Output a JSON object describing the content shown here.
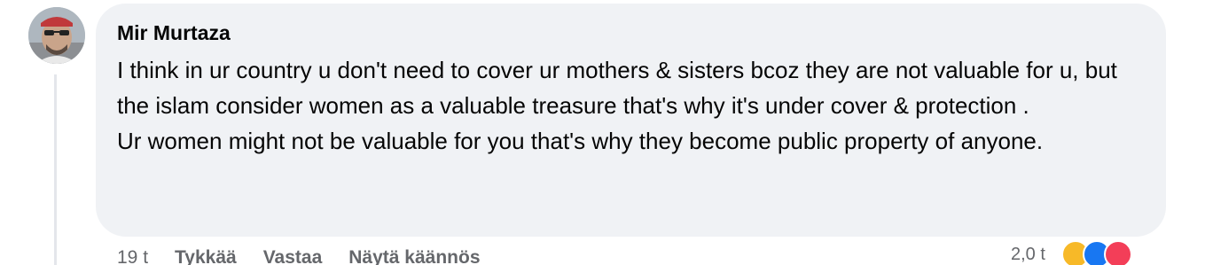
{
  "comment": {
    "author": "Mir Murtaza",
    "text": "I think in ur country u don't need to cover ur mothers & sisters bcoz they are not valuable for u, but the islam consider women as a valuable treasure that's why it's under cover & protection .\nUr women might not be valuable for you that's why they become public property of anyone.",
    "avatar_icon": "avatar-photo"
  },
  "actions": {
    "time": "19 t",
    "like_label": "Tykkää",
    "reply_label": "Vastaa",
    "seen_label": "Näytä käännös"
  },
  "reactions": {
    "count": "2,0 t",
    "icons": [
      "haha-icon",
      "like-icon",
      "love-icon"
    ]
  },
  "colors": {
    "bubble": "#f0f2f5",
    "text": "#050505",
    "secondary": "#65676b"
  }
}
